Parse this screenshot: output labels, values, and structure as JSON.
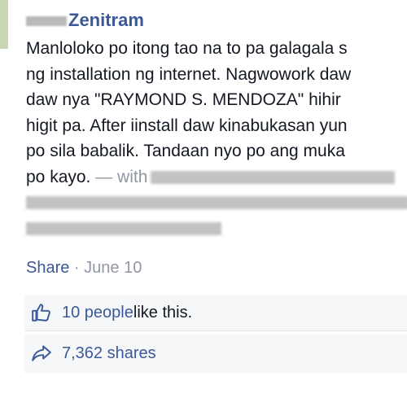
{
  "post": {
    "author_name": "Zenitram",
    "lines": [
      "Manloloko po itong tao na to pa galagala s",
      "ng installation ng internet. Nagwowork daw",
      "daw nya \"RAYMOND S. MENDOZA\" hihir",
      "higit pa. After iinstall daw kinabukasan yun",
      "po sila babalik. Tandaan nyo po ang muka"
    ],
    "line6_text": "po kayo.",
    "with_text": " — with"
  },
  "meta": {
    "share_label": "Share",
    "separator": " · ",
    "date": "June 10"
  },
  "likes": {
    "count_text": "10 people",
    "suffix": " like this."
  },
  "shares": {
    "text": "7,362 shares"
  },
  "colors": {
    "link": "#3b5998",
    "muted": "#9197a3",
    "panel_bg": "#f6f7f9"
  }
}
